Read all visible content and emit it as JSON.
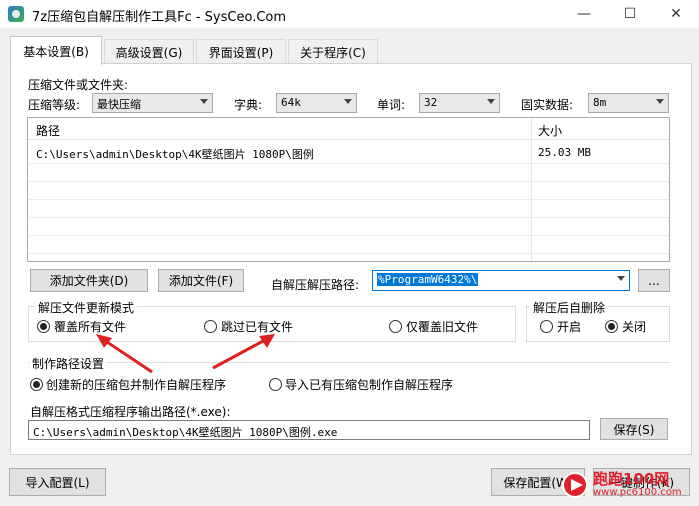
{
  "window": {
    "title": "7z压缩包自解压制作工具Fc - SysCeo.Com",
    "minimize": "—",
    "maximize": "☐",
    "close": "✕"
  },
  "tabs": [
    {
      "label": "基本设置(B)",
      "active": true
    },
    {
      "label": "高级设置(G)",
      "active": false
    },
    {
      "label": "界面设置(P)",
      "active": false
    },
    {
      "label": "关于程序(C)",
      "active": false
    }
  ],
  "compress": {
    "group_label": "压缩文件或文件夹:",
    "level_label": "压缩等级:",
    "level_value": "最快压缩",
    "dict_label": "字典:",
    "dict_value": "64k",
    "word_label": "单词:",
    "word_value": "32",
    "solid_label": "固实数据:",
    "solid_value": "8m"
  },
  "file_list": {
    "columns": [
      "路径",
      "大小"
    ],
    "rows": [
      {
        "path": "C:\\Users\\admin\\Desktop\\4K壁纸图片 1080P\\图例",
        "size": "25.03 MB"
      }
    ]
  },
  "actions": {
    "add_folder": "添加文件夹(D)",
    "add_file": "添加文件(F)",
    "extract_path_label": "自解压解压路径:",
    "extract_path_value": "%ProgramW6432%\\",
    "browse": "..."
  },
  "update_mode": {
    "label": "解压文件更新模式",
    "options": [
      {
        "label": "覆盖所有文件",
        "selected": true
      },
      {
        "label": "跳过已有文件",
        "selected": false
      },
      {
        "label": "仅覆盖旧文件",
        "selected": false
      }
    ]
  },
  "auto_delete": {
    "label": "解压后自删除",
    "options": [
      {
        "label": "开启",
        "selected": false
      },
      {
        "label": "关闭",
        "selected": true
      }
    ]
  },
  "make_path": {
    "label": "制作路径设置",
    "options": [
      {
        "label": "创建新的压缩包并制作自解压程序",
        "selected": true
      },
      {
        "label": "导入已有压缩包制作自解压程序",
        "selected": false
      }
    ],
    "output_label": "自解压格式压缩程序输出路径(*.exe):",
    "output_value": "C:\\Users\\admin\\Desktop\\4K壁纸图片 1080P\\图例.exe",
    "save": "保存(S)"
  },
  "footer": {
    "import": "导入配置(L)",
    "save_config": "保存配置(W)",
    "make": "一键制作(K)"
  },
  "watermark": {
    "text": "跑跑100网",
    "url": "www.pc6100.com"
  },
  "colors": {
    "accent": "#0078d7",
    "annotation_arrow": "#e02020",
    "watermark": "#e0202a"
  }
}
